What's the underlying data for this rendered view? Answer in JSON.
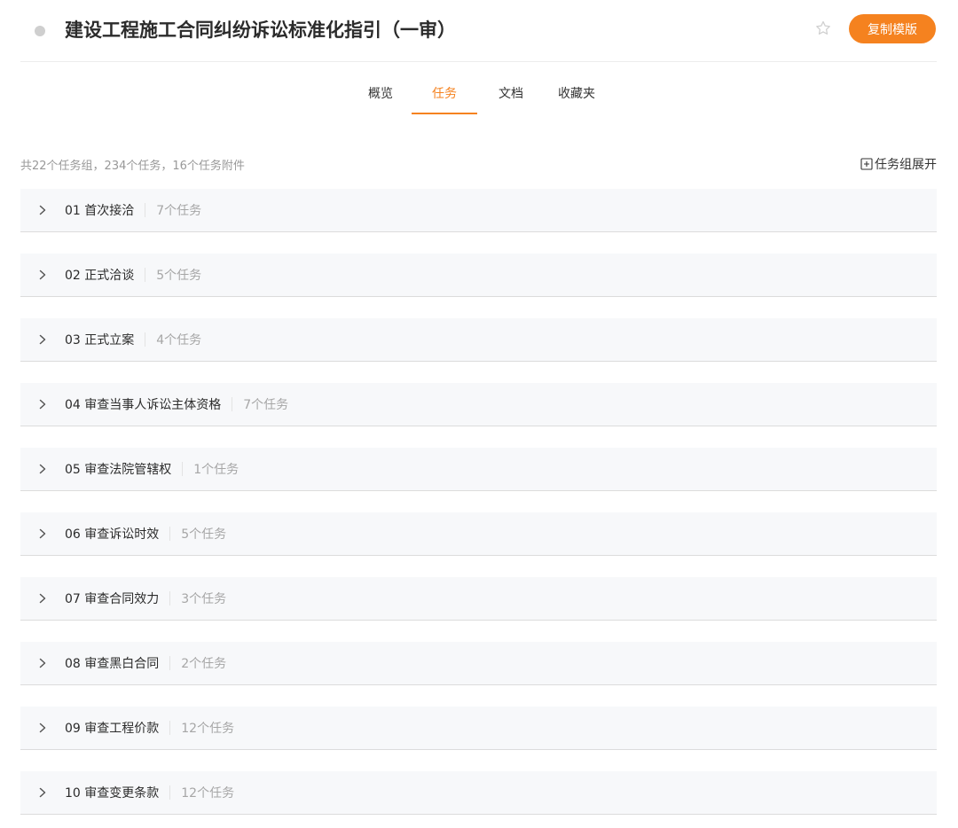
{
  "header": {
    "title": "建设工程施工合同纠纷诉讼标准化指引（一审）",
    "star_icon": "star-outline-icon",
    "copy_button_label": "复制模版",
    "accent_color": "#f5821f"
  },
  "tabs": [
    {
      "label": "概览",
      "active": false
    },
    {
      "label": "任务",
      "active": true
    },
    {
      "label": "文档",
      "active": false
    },
    {
      "label": "收藏夹",
      "active": false
    }
  ],
  "summary": {
    "text": "共22个任务组，234个任务，16个任务附件",
    "expand_all_label": "任务组展开",
    "expand_icon": "plus-square-icon"
  },
  "task_groups": [
    {
      "name": "01 首次接洽",
      "count": "7个任务"
    },
    {
      "name": "02 正式洽谈",
      "count": "5个任务"
    },
    {
      "name": "03 正式立案",
      "count": "4个任务"
    },
    {
      "name": "04 审查当事人诉讼主体资格",
      "count": "7个任务"
    },
    {
      "name": "05 审查法院管辖权",
      "count": "1个任务"
    },
    {
      "name": "06 审查诉讼时效",
      "count": "5个任务"
    },
    {
      "name": "07 审查合同效力",
      "count": "3个任务"
    },
    {
      "name": "08 审查黑白合同",
      "count": "2个任务"
    },
    {
      "name": "09 审查工程价款",
      "count": "12个任务"
    },
    {
      "name": "10 审查变更条款",
      "count": "12个任务"
    }
  ]
}
